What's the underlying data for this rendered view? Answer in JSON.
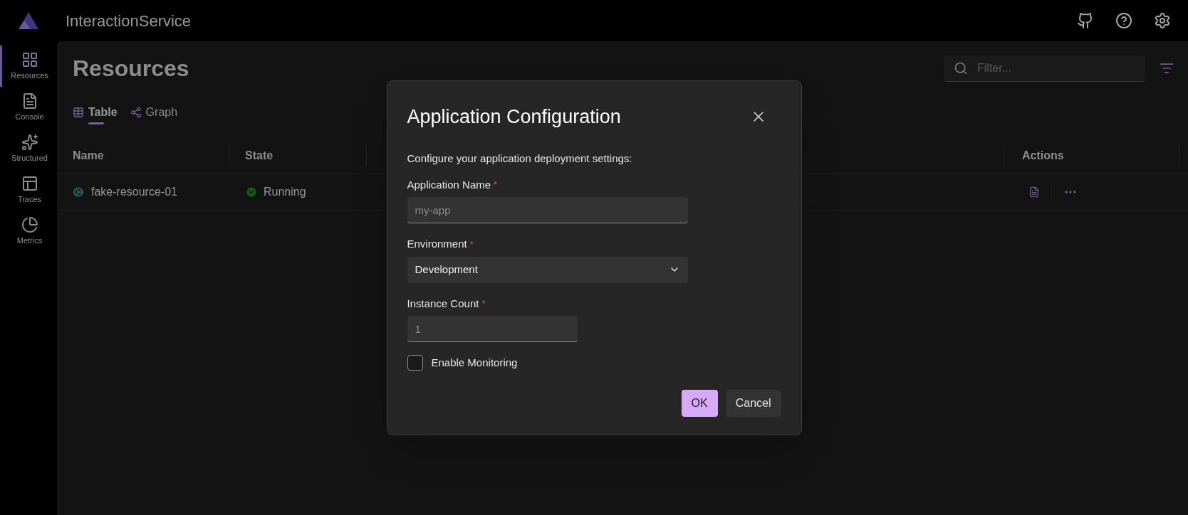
{
  "header": {
    "title": "InteractionService"
  },
  "nav": [
    {
      "label": "Resources",
      "kind": "resources",
      "selected": true
    },
    {
      "label": "Console",
      "kind": "console",
      "selected": false
    },
    {
      "label": "Structured",
      "kind": "structured",
      "selected": false
    },
    {
      "label": "Traces",
      "kind": "traces",
      "selected": false
    },
    {
      "label": "Metrics",
      "kind": "metrics",
      "selected": false
    }
  ],
  "page": {
    "title": "Resources",
    "filter": {
      "placeholder": "Filter..."
    }
  },
  "views": [
    {
      "label": "Table",
      "kind": "table",
      "selected": true
    },
    {
      "label": "Graph",
      "kind": "graph",
      "selected": false
    }
  ],
  "table": {
    "columns": [
      "Name",
      "State",
      "Actions"
    ],
    "rows": [
      {
        "name": "fake-resource-01",
        "state": "Running"
      }
    ]
  },
  "dialog": {
    "title": "Application Configuration",
    "description": "Configure your application deployment settings:",
    "fields": [
      {
        "kind": "text",
        "label": "Application Name",
        "required_mark": "*",
        "placeholder": "my-app"
      },
      {
        "kind": "select",
        "label": "Environment",
        "required_mark": "*",
        "value": "Development"
      },
      {
        "kind": "number",
        "label": "Instance Count",
        "required_mark": "*",
        "placeholder": "1"
      },
      {
        "kind": "checkbox",
        "label": "Enable Monitoring",
        "checked": false
      }
    ],
    "buttons": [
      {
        "label": "OK",
        "kind": "primary"
      },
      {
        "label": "Cancel",
        "kind": "secondary"
      }
    ]
  }
}
